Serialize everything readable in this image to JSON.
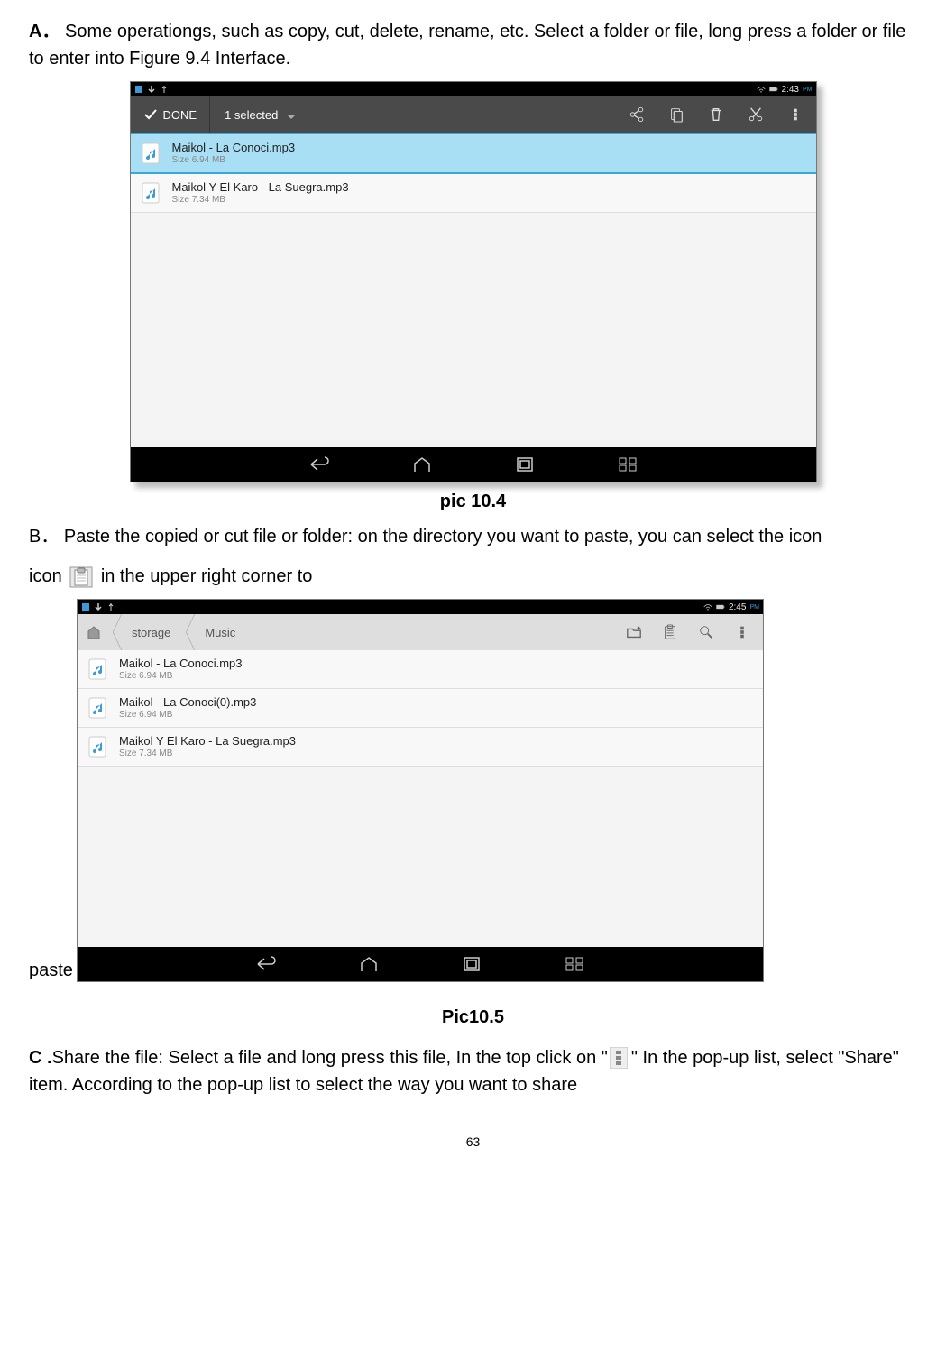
{
  "section_a": {
    "label": "A．",
    "text": "Some operationgs, such as copy, cut, delete, rename, etc. Select a folder or file, long press a folder or file to enter into Figure 9.4 Interface."
  },
  "fig1": {
    "caption": "pic 10.4",
    "status_time": "2:43",
    "status_ampm": "PM",
    "cab_done": "DONE",
    "cab_selected": "1 selected",
    "files": [
      {
        "name": "Maikol - La Conoci.mp3",
        "size": "Size 6.94 MB",
        "selected": true
      },
      {
        "name": "Maikol Y El Karo - La Suegra.mp3",
        "size": "Size 7.34 MB",
        "selected": false
      }
    ]
  },
  "section_b": {
    "label": "B．",
    "text1": "Paste the copied or cut file or folder: on the directory you want to paste, you can select the icon ",
    "text2": "in the upper right corner to",
    "paste_word": "paste"
  },
  "fig2": {
    "caption": "Pic10.5",
    "status_time": "2:45",
    "status_ampm": "PM",
    "crumbs": [
      "storage",
      "Music"
    ],
    "files": [
      {
        "name": "Maikol - La Conoci.mp3",
        "size": "Size 6.94 MB"
      },
      {
        "name": "Maikol - La Conoci(0).mp3",
        "size": "Size 6.94 MB"
      },
      {
        "name": "Maikol Y El Karo - La Suegra.mp3",
        "size": "Size 7.34 MB"
      }
    ]
  },
  "section_c": {
    "label": "C .",
    "text1": "Share the file: Select a file and long press this file, In the top click on \"",
    "text2": "\" In the pop-up list, select \"Share\" item. According to the pop-up list to select the way you want to share"
  },
  "page_number": "63"
}
